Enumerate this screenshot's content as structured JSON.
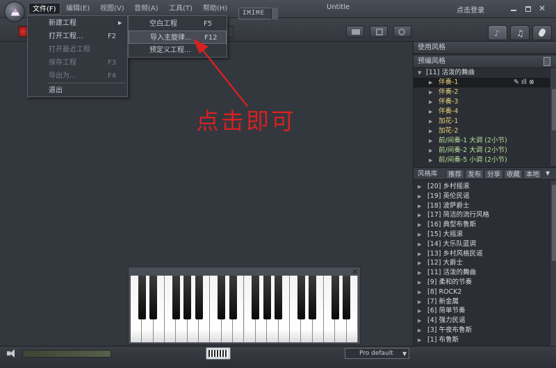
{
  "window": {
    "title": "Untitle",
    "login": "点击登录"
  },
  "menubar": [
    {
      "label": "文件(F)"
    },
    {
      "label": "编辑(E)"
    },
    {
      "label": "视图(V)"
    },
    {
      "label": "音频(A)"
    },
    {
      "label": "工具(T)"
    },
    {
      "label": "帮助(H)"
    }
  ],
  "toolbar": {
    "input_method": "IMIME"
  },
  "file_menu": {
    "items": [
      {
        "label": "新建工程",
        "key": "",
        "submenu": true
      },
      {
        "label": "打开工程...",
        "key": "F2"
      },
      {
        "label": "打开最近工程",
        "key": "",
        "disabled": true
      },
      {
        "label": "保存工程",
        "key": "F3",
        "disabled": true
      },
      {
        "label": "导出为...",
        "key": "F4",
        "disabled": true
      },
      {
        "label": "退出",
        "key": ""
      }
    ]
  },
  "new_submenu": {
    "items": [
      {
        "label": "空白工程",
        "key": "F5"
      },
      {
        "label": "导入主旋律...",
        "key": "F12",
        "highlighted": true
      },
      {
        "label": "预定义工程...",
        "key": ""
      }
    ]
  },
  "annotation": {
    "text": "点击即可",
    "color": "#d42222"
  },
  "right_panel": {
    "use_style_header": "使用风格",
    "preset_header": "预编风格",
    "preset_root": "[11] 活泼的舞曲",
    "preset_items": [
      {
        "label": "伴奏-1",
        "color": "yellow",
        "selected": true
      },
      {
        "label": "伴奏-2",
        "color": "yellow"
      },
      {
        "label": "伴奏-3",
        "color": "yellow"
      },
      {
        "label": "伴奏-4",
        "color": "yellow"
      },
      {
        "label": "加花-1",
        "color": "yellow"
      },
      {
        "label": "加花-2",
        "color": "yellow"
      },
      {
        "label": "前/间奏-1 大调 (2小节)",
        "color": "green"
      },
      {
        "label": "前/间奏-2 大调 (2小节)",
        "color": "green"
      },
      {
        "label": "前/间奏-5 小调 (2小节)",
        "color": "green"
      }
    ],
    "library_tabs": [
      "风格库",
      "推荐",
      "发布",
      "分享",
      "收藏",
      "本地"
    ],
    "library_items": [
      "[20] 乡村摇滚",
      "[19] 英伦民谣",
      "[18] 波萨爵士",
      "[17] 简洁的流行风格",
      "[16] 典型布鲁斯",
      "[15] 大摇滚",
      "[14] 大乐队蓝调",
      "[13] 乡村风格民谣",
      "[12] 大爵士",
      "[11] 活泼的舞曲",
      "[9] 柔和的节奏",
      "[8] ROCK2",
      "[7] 新金属",
      "[6] 简单节奏",
      "[4] 强力民谣",
      "[3] 午夜布鲁斯",
      "[1] 布鲁斯"
    ]
  },
  "status": {
    "preset": "Pro default"
  }
}
